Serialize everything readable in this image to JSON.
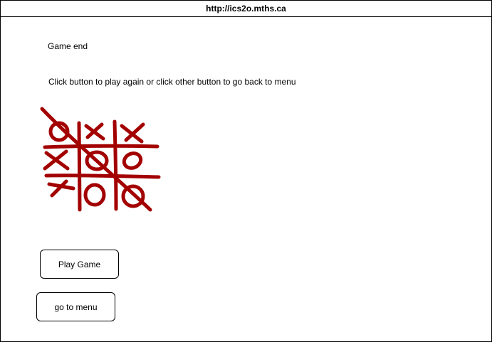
{
  "window": {
    "url": "http://ics2o.mths.ca"
  },
  "main": {
    "heading": "Game end",
    "instructions": "Click button to play again or click other button to go back to menu",
    "image": {
      "icon": "tic-tac-toe-board",
      "color": "#a30000"
    }
  },
  "buttons": {
    "play_label": "Play Game",
    "menu_label": "go to menu"
  }
}
